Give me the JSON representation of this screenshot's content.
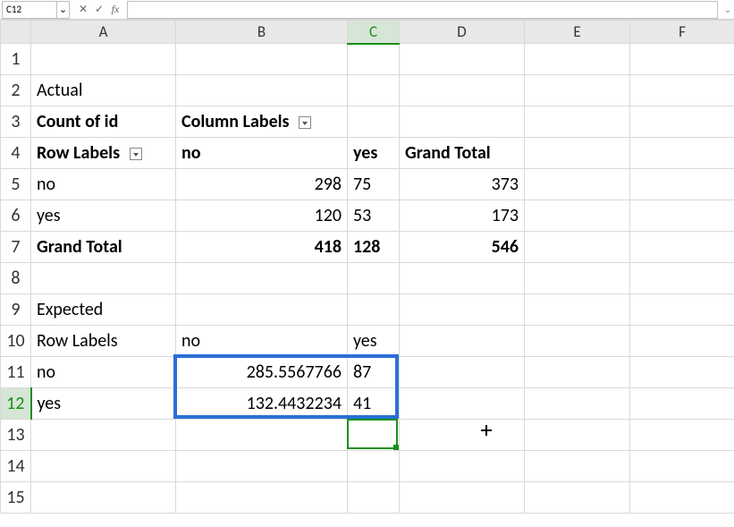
{
  "name_box": "C12",
  "formula_value": "",
  "col_headers": [
    "A",
    "B",
    "C",
    "D",
    "E",
    "F"
  ],
  "rows": [
    "1",
    "2",
    "3",
    "4",
    "5",
    "6",
    "7",
    "8",
    "9",
    "10",
    "11",
    "12",
    "13",
    "14",
    "15"
  ],
  "cells": {
    "A2": "Actual",
    "A3": "Count of id",
    "B3": "Column Labels",
    "A4": "Row Labels",
    "B4": "no",
    "C4": "yes",
    "D4": "Grand Total",
    "A5": "no",
    "B5": "298",
    "C5": "75",
    "D5": "373",
    "A6": "yes",
    "B6": "120",
    "C6": "53",
    "D6": "173",
    "A7": "Grand Total",
    "B7": "418",
    "C7": "128",
    "D7": "546",
    "A9": "Expected",
    "A10": "Row Labels",
    "B10": "no",
    "C10": "yes",
    "A11": "no",
    "B11": "285.5567766",
    "C11": "87",
    "A12": "yes",
    "B12": "132.4432234",
    "C12": "41"
  },
  "glyphs": {
    "cancel": "✕",
    "confirm": "✓",
    "fx": "fx",
    "chevron": "⌄"
  }
}
